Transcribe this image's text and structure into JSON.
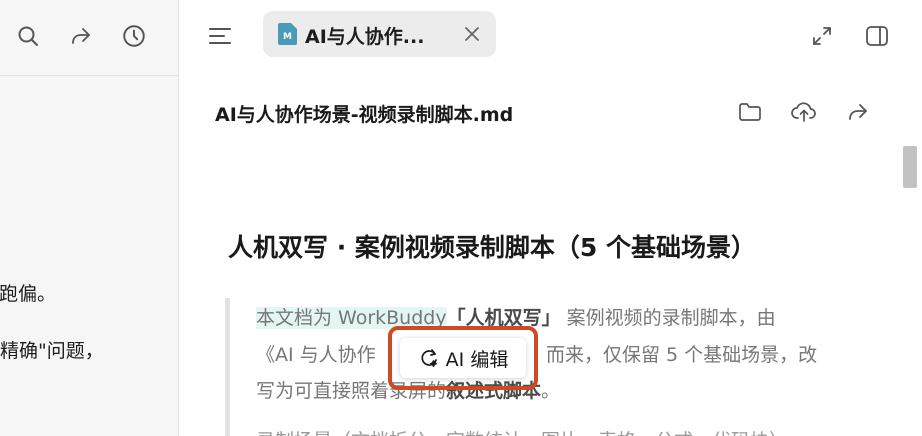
{
  "left_panel": {
    "toolbar": {
      "search_icon": "search-icon",
      "share_icon": "share-icon",
      "history_icon": "clock-icon"
    },
    "lines": [
      {
        "text": "生跑偏。"
      },
      {
        "text": "不精确\"问题，"
      }
    ]
  },
  "tabbar": {
    "menu_icon": "menu-icon",
    "tab": {
      "title": "AI与人协作...",
      "file_icon": "markdown-file-icon",
      "file_icon_letter": "M"
    },
    "close_icon": "close-icon",
    "expand_icon": "expand-icon",
    "sidebar_icon": "sidebar-toggle-icon"
  },
  "document": {
    "filename": "AI与人协作场景-视频录制脚本.md",
    "actions": [
      "folder-icon",
      "upload-icon",
      "share-icon"
    ],
    "heading": "人机双写 · 案例视频录制脚本（5 个基础场景）",
    "quote": {
      "line1": {
        "highlighted": "本文档为 WorkBuddy",
        "bold": "「人机双写」",
        "rest": " 案例视频的录制脚本，由"
      },
      "line2": {
        "start": "《AI 与人协作",
        "end": "而来，仅保留 5 个基础场景，改"
      },
      "line3": {
        "start": "写为可直接照着录屏的",
        "bold": "叙述式脚本",
        "end": "。"
      },
      "line4": {
        "text": "录制场景（文档拆分、字数统计、图片、表格、公式、代码块）"
      }
    }
  },
  "ai_popup": {
    "label": "AI 编辑",
    "icon": "ai-edit-icon",
    "highlight_color": "#cc4a24"
  },
  "colors": {
    "accent": "#cc4a24",
    "highlight": "#e3f6f1",
    "file_icon": "#4a9bb5"
  }
}
